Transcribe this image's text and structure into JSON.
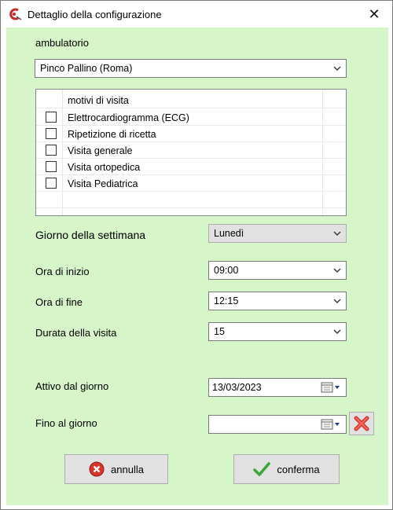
{
  "window": {
    "title": "Dettaglio della configurazione",
    "close_glyph": "✕"
  },
  "form": {
    "ambulatorio_label": "ambulatorio",
    "ambulatorio_value": "Pinco Pallino (Roma)",
    "motivi": {
      "header": "motivi di visita",
      "items": [
        {
          "label": "Elettrocardiogramma (ECG)",
          "checked": false
        },
        {
          "label": "Ripetizione di ricetta",
          "checked": false
        },
        {
          "label": "Visita generale",
          "checked": false
        },
        {
          "label": "Visita ortopedica",
          "checked": false
        },
        {
          "label": "Visita Pediatrica",
          "checked": false
        }
      ]
    },
    "giorno_label": "Giorno della settimana",
    "giorno_value": "Lunedì",
    "ora_inizio_label": "Ora di inizio",
    "ora_inizio_value": "09:00",
    "ora_fine_label": "Ora di fine",
    "ora_fine_value": "12:15",
    "durata_label": "Durata della visita",
    "durata_value": "15",
    "attivo_label": "Attivo dal giorno",
    "attivo_value": "13/03/2023",
    "fino_label": "Fino al giorno",
    "fino_value": ""
  },
  "buttons": {
    "annulla": "annulla",
    "conferma": "conferma"
  },
  "colors": {
    "client_bg": "#d6f5c9",
    "cancel_red": "#d9332b",
    "confirm_green": "#3aa635"
  }
}
